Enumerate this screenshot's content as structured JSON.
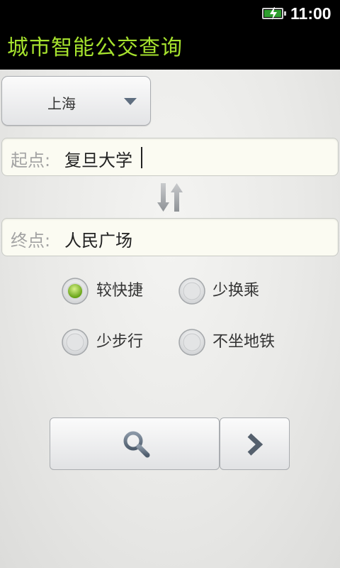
{
  "status_bar": {
    "time": "11:00",
    "battery_icon": "battery-charging-icon"
  },
  "app": {
    "title": "城市智能公交查询",
    "title_color": "#a6e22e"
  },
  "city_select": {
    "value": "上海",
    "icon": "dropdown-triangle-icon"
  },
  "route": {
    "start_prefix": "起点:",
    "start_value": "复旦大学",
    "end_prefix": "终点:",
    "end_value": "人民广场",
    "swap_icon": "swap-vertical-arrows-icon"
  },
  "options": [
    {
      "label": "较快捷",
      "selected": true
    },
    {
      "label": "少换乘",
      "selected": false
    },
    {
      "label": "少步行",
      "selected": false
    },
    {
      "label": "不坐地铁",
      "selected": false
    }
  ],
  "actions": {
    "search_icon": "search-icon",
    "next_icon": "chevron-right-icon"
  }
}
